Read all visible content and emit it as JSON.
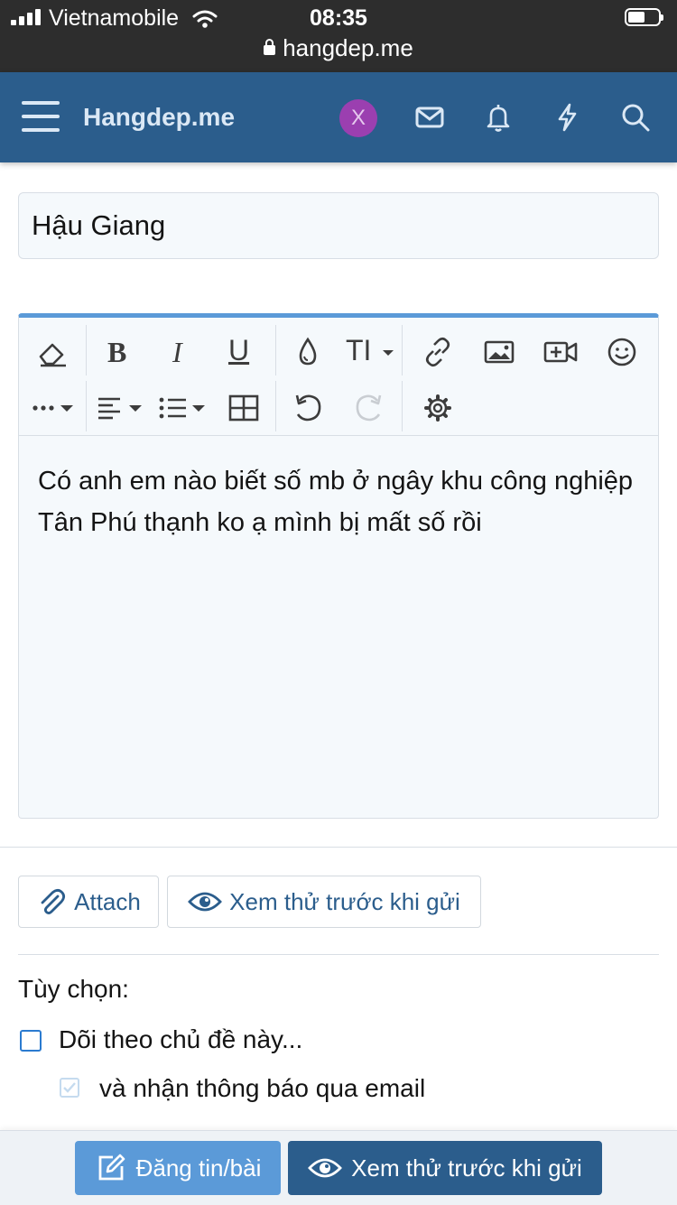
{
  "status_bar": {
    "carrier": "Vietnamobile",
    "time": "08:35",
    "url": "hangdep.me",
    "icons": [
      "signal-icon",
      "wifi-icon",
      "lock-icon",
      "battery-icon"
    ]
  },
  "navbar": {
    "brand": "Hangdep.me",
    "avatar_letter": "X",
    "avatar_color": "#9b3fb0",
    "bg_color": "#2b5d8c",
    "icons": [
      "menu-icon",
      "inbox-icon",
      "bell-icon",
      "lightning-icon",
      "search-icon"
    ]
  },
  "form": {
    "title_value": "Hậu Giang",
    "message": "Có anh em nào biết số mb ở ngây khu công nghiệp Tân Phú thạnh ko ạ mình bị mất số rồi"
  },
  "toolbar": {
    "row1": [
      "eraser-icon",
      "bold-icon",
      "italic-icon",
      "underline-icon",
      "color-drop-icon",
      "font-size-icon",
      "link-icon",
      "image-icon",
      "video-icon",
      "smiley-icon"
    ],
    "row2": [
      "more-icon",
      "align-icon",
      "list-icon",
      "table-icon",
      "undo-icon",
      "redo-icon",
      "settings-icon"
    ],
    "bold_label": "B",
    "italic_label": "I",
    "underline_label": "U",
    "font_size_label": "TI"
  },
  "actions": {
    "attach_label": "Attach",
    "preview_label": "Xem thử trước khi gửi"
  },
  "options": {
    "heading": "Tùy chọn:",
    "watch_label": "Dõi theo chủ đề này...",
    "watch_checked": false,
    "email_label": "và nhận thông báo qua email",
    "email_checked": true
  },
  "footer": {
    "post_label": "Đăng tin/bài",
    "preview_label": "Xem thử trước khi gửi",
    "post_color": "#5b9ad8",
    "preview_color": "#2b5d8c"
  }
}
